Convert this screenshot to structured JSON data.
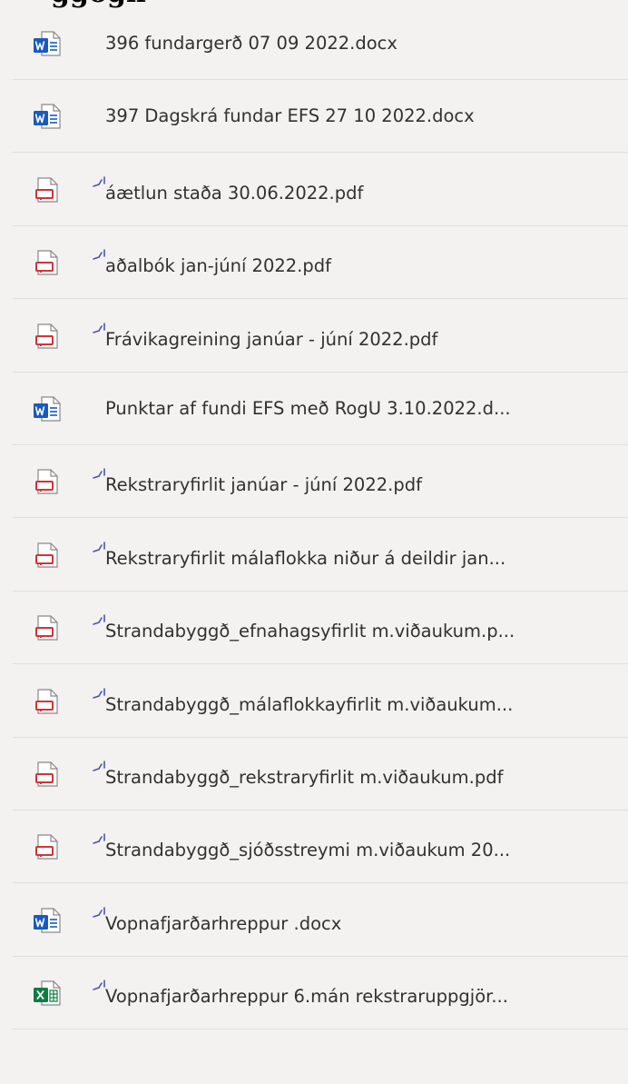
{
  "heading_fragment": "ggogn",
  "files": [
    {
      "name": "396 fundargerð 07 09 2022.docx",
      "type": "word",
      "icon": "word-doc-icon",
      "new": false
    },
    {
      "name": "397 Dagskrá fundar EFS 27 10 2022.docx",
      "type": "word",
      "icon": "word-doc-icon",
      "new": false
    },
    {
      "name": "áætlun staða 30.06.2022.pdf",
      "type": "pdf",
      "icon": "pdf-file-icon",
      "new": true
    },
    {
      "name": "aðalbók jan-júní 2022.pdf",
      "type": "pdf",
      "icon": "pdf-file-icon",
      "new": true
    },
    {
      "name": "Frávikagreining janúar - júní 2022.pdf",
      "type": "pdf",
      "icon": "pdf-file-icon",
      "new": true
    },
    {
      "name": "Punktar af fundi EFS með RogU 3.10.2022.d...",
      "type": "word",
      "icon": "word-doc-icon",
      "new": false
    },
    {
      "name": "Rekstraryfirlit  janúar - júní 2022.pdf",
      "type": "pdf",
      "icon": "pdf-file-icon",
      "new": true
    },
    {
      "name": "Rekstraryfirlit málaflokka niður á deildir jan...",
      "type": "pdf",
      "icon": "pdf-file-icon",
      "new": true
    },
    {
      "name": "Strandabyggð_efnahagsyfirlit m.viðaukum.p...",
      "type": "pdf",
      "icon": "pdf-file-icon",
      "new": true
    },
    {
      "name": "Strandabyggð_málaflokkayfirlit m.viðaukum...",
      "type": "pdf",
      "icon": "pdf-file-icon",
      "new": true
    },
    {
      "name": "Strandabyggð_rekstraryfirlit m.viðaukum.pdf",
      "type": "pdf",
      "icon": "pdf-file-icon",
      "new": true
    },
    {
      "name": "Strandabyggð_sjóðsstreymi m.viðaukum 20...",
      "type": "pdf",
      "icon": "pdf-file-icon",
      "new": true
    },
    {
      "name": "Vopnafjarðarhreppur .docx",
      "type": "word",
      "icon": "word-doc-icon",
      "new": true
    },
    {
      "name": "Vopnafjarðarhreppur 6.mán rekstraruppgjör...",
      "type": "excel",
      "icon": "excel-file-icon",
      "new": true
    }
  ],
  "colors": {
    "background": "#f3f2f1",
    "text": "#323130",
    "divider": "#e1dfdd",
    "word": "#185abd",
    "pdf": "#d13438",
    "excel": "#107c41",
    "new_indicator": "#4f52b2"
  }
}
